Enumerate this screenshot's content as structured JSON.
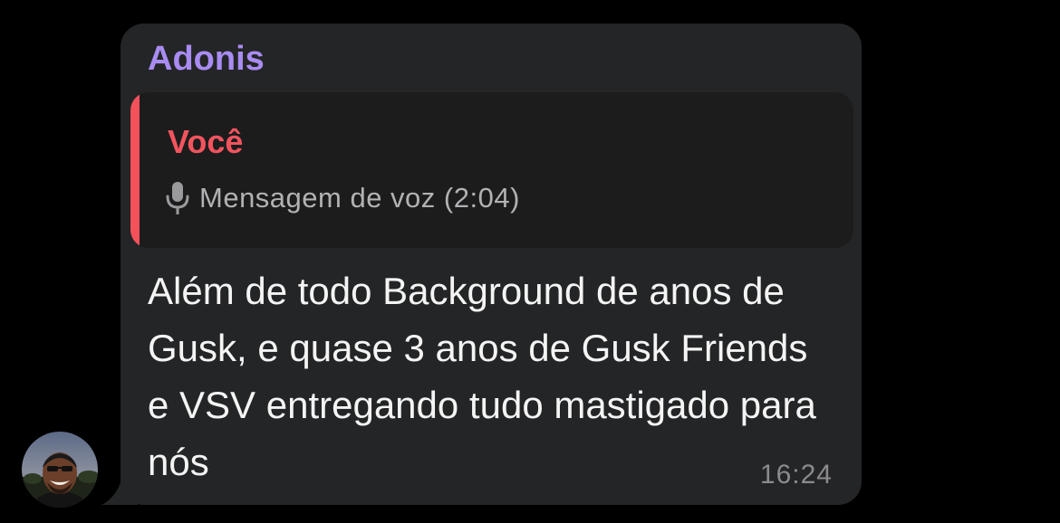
{
  "message": {
    "sender": "Adonis",
    "reply": {
      "author": "Você",
      "icon": "microphone-icon",
      "preview": "Mensagem de voz (2:04)"
    },
    "text": "Além de todo Background de anos de Gusk, e quase 3 anos de Gusk Friends e VSV entregando tudo mastigado para nós",
    "time": "16:24"
  },
  "colors": {
    "background": "#000000",
    "bubble": "#242526",
    "reply_background": "#1c1c1d",
    "sender": "#a88cf2",
    "reply_accent": "#f4515b",
    "text": "#f4f4f4",
    "secondary_text": "#b2b2b4",
    "time": "#8b8b8e"
  }
}
